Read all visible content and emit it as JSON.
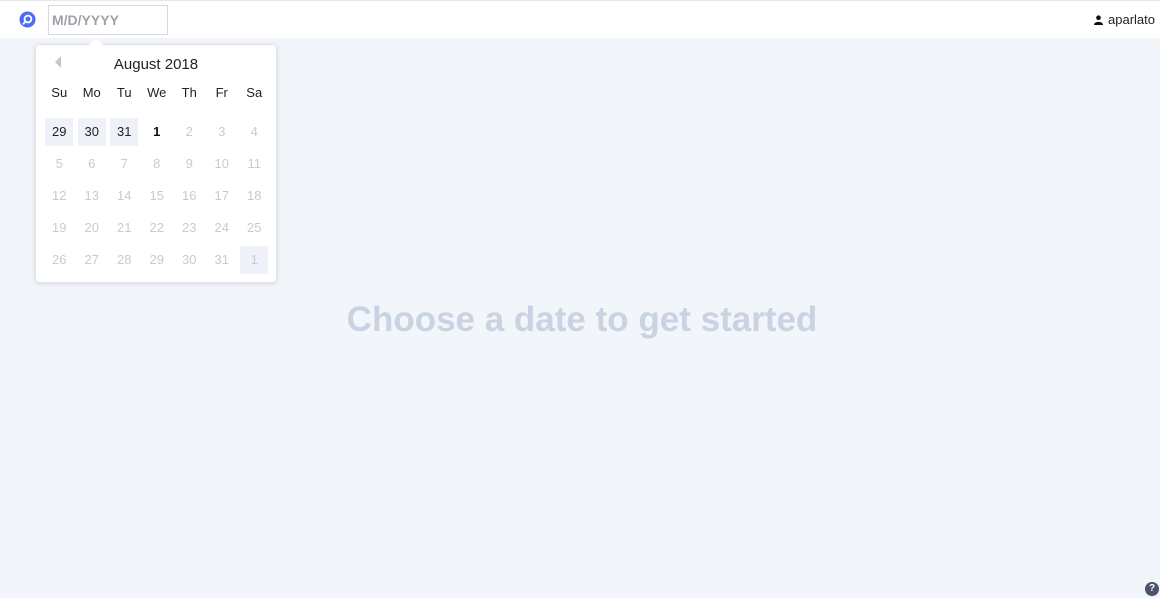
{
  "header": {
    "date_input_placeholder": "M/D/YYYY",
    "username": "aparlato"
  },
  "calendar": {
    "month_title": "August 2018",
    "weekdays": [
      "Su",
      "Mo",
      "Tu",
      "We",
      "Th",
      "Fr",
      "Sa"
    ],
    "weeks": [
      [
        {
          "d": "29",
          "state": "active",
          "hl": true
        },
        {
          "d": "30",
          "state": "active",
          "hl": true
        },
        {
          "d": "31",
          "state": "active",
          "hl": true
        },
        {
          "d": "1",
          "state": "today",
          "hl": false
        },
        {
          "d": "2",
          "state": "disabled",
          "hl": false
        },
        {
          "d": "3",
          "state": "disabled",
          "hl": false
        },
        {
          "d": "4",
          "state": "disabled",
          "hl": false
        }
      ],
      [
        {
          "d": "5",
          "state": "disabled",
          "hl": false
        },
        {
          "d": "6",
          "state": "disabled",
          "hl": false
        },
        {
          "d": "7",
          "state": "disabled",
          "hl": false
        },
        {
          "d": "8",
          "state": "disabled",
          "hl": false
        },
        {
          "d": "9",
          "state": "disabled",
          "hl": false
        },
        {
          "d": "10",
          "state": "disabled",
          "hl": false
        },
        {
          "d": "11",
          "state": "disabled",
          "hl": false
        }
      ],
      [
        {
          "d": "12",
          "state": "disabled",
          "hl": false
        },
        {
          "d": "13",
          "state": "disabled",
          "hl": false
        },
        {
          "d": "14",
          "state": "disabled",
          "hl": false
        },
        {
          "d": "15",
          "state": "disabled",
          "hl": false
        },
        {
          "d": "16",
          "state": "disabled",
          "hl": false
        },
        {
          "d": "17",
          "state": "disabled",
          "hl": false
        },
        {
          "d": "18",
          "state": "disabled",
          "hl": false
        }
      ],
      [
        {
          "d": "19",
          "state": "disabled",
          "hl": false
        },
        {
          "d": "20",
          "state": "disabled",
          "hl": false
        },
        {
          "d": "21",
          "state": "disabled",
          "hl": false
        },
        {
          "d": "22",
          "state": "disabled",
          "hl": false
        },
        {
          "d": "23",
          "state": "disabled",
          "hl": false
        },
        {
          "d": "24",
          "state": "disabled",
          "hl": false
        },
        {
          "d": "25",
          "state": "disabled",
          "hl": false
        }
      ],
      [
        {
          "d": "26",
          "state": "disabled",
          "hl": false
        },
        {
          "d": "27",
          "state": "disabled",
          "hl": false
        },
        {
          "d": "28",
          "state": "disabled",
          "hl": false
        },
        {
          "d": "29",
          "state": "disabled",
          "hl": false
        },
        {
          "d": "30",
          "state": "disabled",
          "hl": false
        },
        {
          "d": "31",
          "state": "disabled",
          "hl": false
        },
        {
          "d": "1",
          "state": "disabled",
          "hl": true
        }
      ]
    ]
  },
  "main": {
    "empty_title": "Choose a date to get started"
  },
  "help": {
    "glyph": "?"
  },
  "colors": {
    "brand": "#4a6cf7",
    "page_bg": "#f2f5fa",
    "empty_title": "#c9d3e2"
  }
}
